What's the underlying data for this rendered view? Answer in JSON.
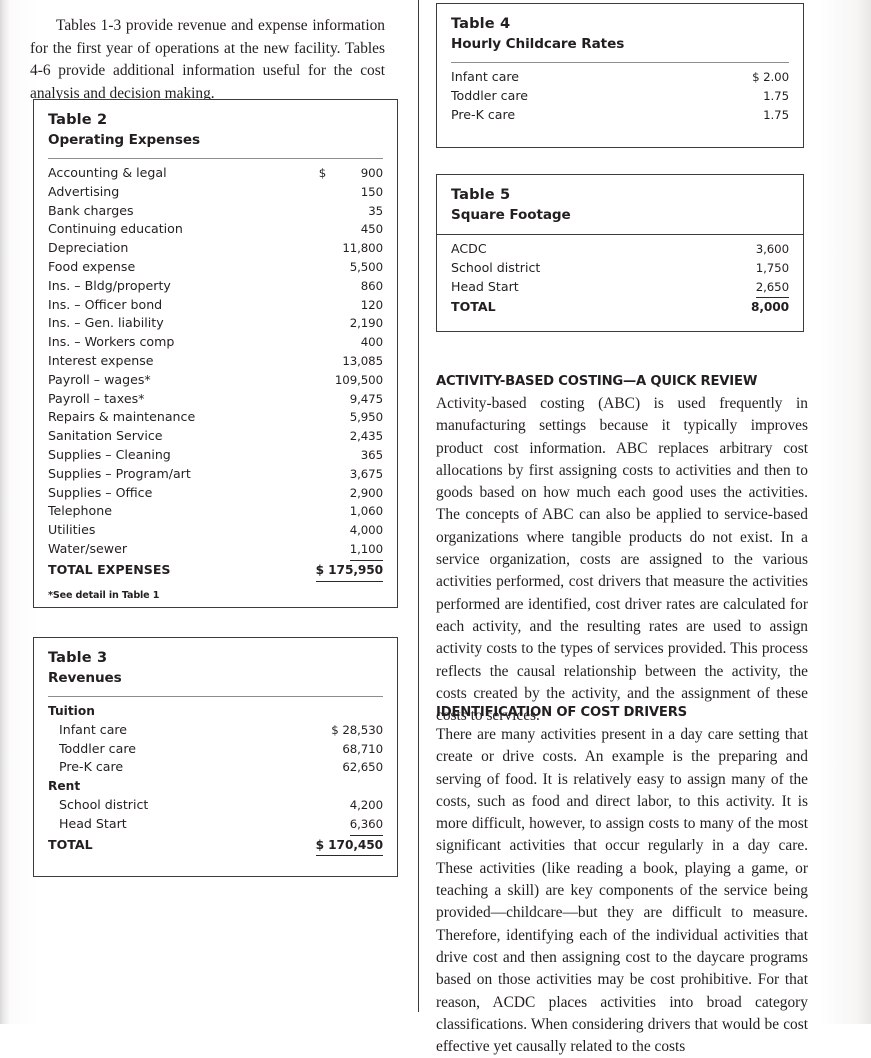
{
  "document": {
    "intro_paragraph": "Tables 1-3 provide revenue and expense information for the first year of operations at the new facility. Tables 4-6 provide additional information useful for the cost analysis and decision making."
  },
  "table2": {
    "number": "Table 2",
    "title": "Operating Expenses",
    "currency_symbol": "$",
    "rows": [
      {
        "label": "Accounting & legal",
        "value": "900",
        "currency": "$"
      },
      {
        "label": "Advertising",
        "value": "150"
      },
      {
        "label": "Bank charges",
        "value": "35"
      },
      {
        "label": "Continuing education",
        "value": "450"
      },
      {
        "label": "Depreciation",
        "value": "11,800"
      },
      {
        "label": "Food expense",
        "value": "5,500"
      },
      {
        "label": "Ins. – Bldg/property",
        "value": "860"
      },
      {
        "label": "Ins. – Officer bond",
        "value": "120"
      },
      {
        "label": "Ins. – Gen. liability",
        "value": "2,190"
      },
      {
        "label": "Ins. – Workers comp",
        "value": "400"
      },
      {
        "label": "Interest expense",
        "value": "13,085"
      },
      {
        "label": "Payroll – wages*",
        "value": "109,500"
      },
      {
        "label": "Payroll – taxes*",
        "value": "9,475"
      },
      {
        "label": "Repairs & maintenance",
        "value": "5,950"
      },
      {
        "label": "Sanitation Service",
        "value": "2,435"
      },
      {
        "label": "Supplies – Cleaning",
        "value": "365"
      },
      {
        "label": "Supplies – Program/art",
        "value": "3,675"
      },
      {
        "label": "Supplies – Office",
        "value": "2,900"
      },
      {
        "label": "Telephone",
        "value": "1,060"
      },
      {
        "label": "Utilities",
        "value": "4,000"
      },
      {
        "label": "Water/sewer",
        "value": "1,100",
        "rule_above": true
      }
    ],
    "total_label": "TOTAL EXPENSES",
    "total_value": "$ 175,950",
    "footnote": "*See detail in Table 1"
  },
  "table3": {
    "number": "Table 3",
    "title": "Revenues",
    "rows": [
      {
        "label": "Tuition",
        "type": "group"
      },
      {
        "label": "Infant care",
        "value": "$ 28,530",
        "type": "item"
      },
      {
        "label": "Toddler care",
        "value": "68,710",
        "type": "item"
      },
      {
        "label": "Pre-K care",
        "value": "62,650",
        "type": "item"
      },
      {
        "label": "Rent",
        "type": "group"
      },
      {
        "label": "School district",
        "value": "4,200",
        "type": "item"
      },
      {
        "label": "Head Start",
        "value": "6,360",
        "type": "item",
        "rule_above": true
      }
    ],
    "total_label": "TOTAL",
    "total_value": "$ 170,450"
  },
  "table4": {
    "number": "Table 4",
    "title": "Hourly Childcare Rates",
    "rows": [
      {
        "label": "Infant care",
        "value": "$ 2.00"
      },
      {
        "label": "Toddler care",
        "value": "1.75"
      },
      {
        "label": "Pre-K care",
        "value": "1.75"
      }
    ]
  },
  "table5": {
    "number": "Table 5",
    "title": "Square Footage",
    "rows": [
      {
        "label": "ACDC",
        "value": "3,600"
      },
      {
        "label": "School district",
        "value": "1,750"
      },
      {
        "label": "Head Start",
        "value": "2,650",
        "rule_above": true
      }
    ],
    "total_label": "TOTAL",
    "total_value": "8,000"
  },
  "section_abc": {
    "heading": "ACTIVITY-BASED COSTING—A QUICK REVIEW",
    "body": "Activity-based costing (ABC) is used frequently in manufacturing settings because it typically improves product cost information. ABC replaces arbitrary cost allocations by first assigning costs to activities and then to goods based on how much each good uses the activities. The concepts of ABC can also be applied to service-based organizations where tangible products do not exist. In a service organization, costs are assigned to the various activities performed, cost drivers that measure the activities performed are identified, cost driver rates are calculated for each activity, and the resulting rates are used to assign activity costs to the types of services provided. This process reflects the causal relationship between the activity, the costs created by the activity, and the assignment of these costs to services."
  },
  "section_drivers": {
    "heading": "IDENTIFICATION OF COST DRIVERS",
    "body": "There are many activities present in a day care setting that create or drive costs. An example is the preparing and serving of food. It is relatively easy to assign many of the costs, such as food and direct labor, to this activity. It is more difficult, however, to assign costs to many of the most significant activities that occur regularly in a day care. These activities (like reading a book, playing a game, or teaching a skill) are key components of the service being provided—childcare—but they are difficult to measure. Therefore, identifying each of the individual activities that drive cost and then assigning cost to the daycare programs based on those activities may be cost prohibitive. For that reason, ACDC places activities into broad category classifications. When considering drivers that would be cost effective yet causally related to the costs"
  }
}
